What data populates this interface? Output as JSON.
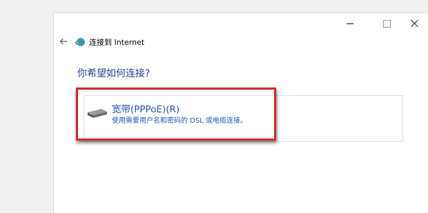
{
  "window": {
    "title": "连接到 Internet",
    "heading": "你希望如何连接?",
    "controls": {
      "minimize": "minimize",
      "maximize": "maximize",
      "close": "close"
    }
  },
  "options": [
    {
      "title": "宽带(PPPoE)(R)",
      "description": "使用需要用户名和密码的 DSL 或电缆连接。",
      "icon": "modem-icon"
    }
  ],
  "colors": {
    "heading": "#1e3f93",
    "option_text": "#1e55c0",
    "highlight_border": "#e02020",
    "option_border": "#cfe0f2"
  }
}
